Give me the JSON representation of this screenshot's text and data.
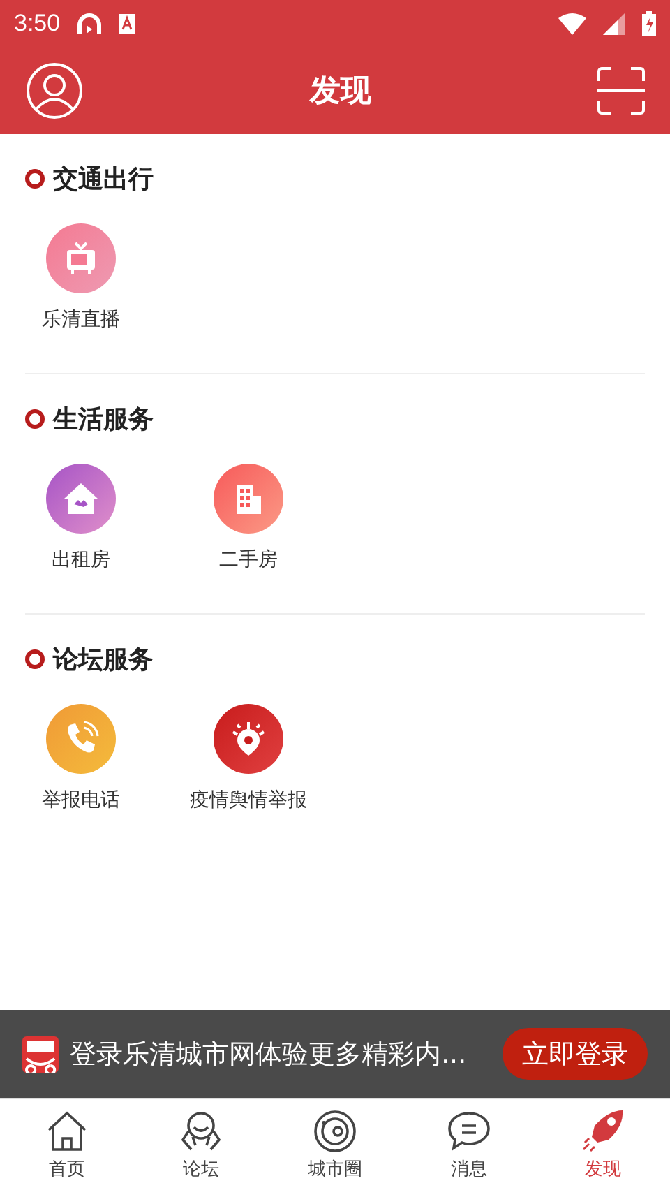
{
  "status_bar": {
    "time": "3:50"
  },
  "header": {
    "title": "发现"
  },
  "sections": [
    {
      "title": "交通出行",
      "items": [
        {
          "label": "乐清直播",
          "kind": "tv"
        }
      ]
    },
    {
      "title": "生活服务",
      "items": [
        {
          "label": "出租房",
          "kind": "house"
        },
        {
          "label": "二手房",
          "kind": "building"
        }
      ]
    },
    {
      "title": "论坛服务",
      "items": [
        {
          "label": "举报电话",
          "kind": "phone"
        },
        {
          "label": "疫情舆情举报",
          "kind": "virus"
        }
      ]
    }
  ],
  "banner": {
    "text": "登录乐清城市网体验更多精彩内...",
    "button": "立即登录"
  },
  "tabs": [
    {
      "label": "首页",
      "kind": "home",
      "selected": false
    },
    {
      "label": "论坛",
      "kind": "forum",
      "selected": false
    },
    {
      "label": "城市圈",
      "kind": "circle",
      "selected": false
    },
    {
      "label": "消息",
      "kind": "message",
      "selected": false
    },
    {
      "label": "发现",
      "kind": "rocket",
      "selected": true
    }
  ]
}
